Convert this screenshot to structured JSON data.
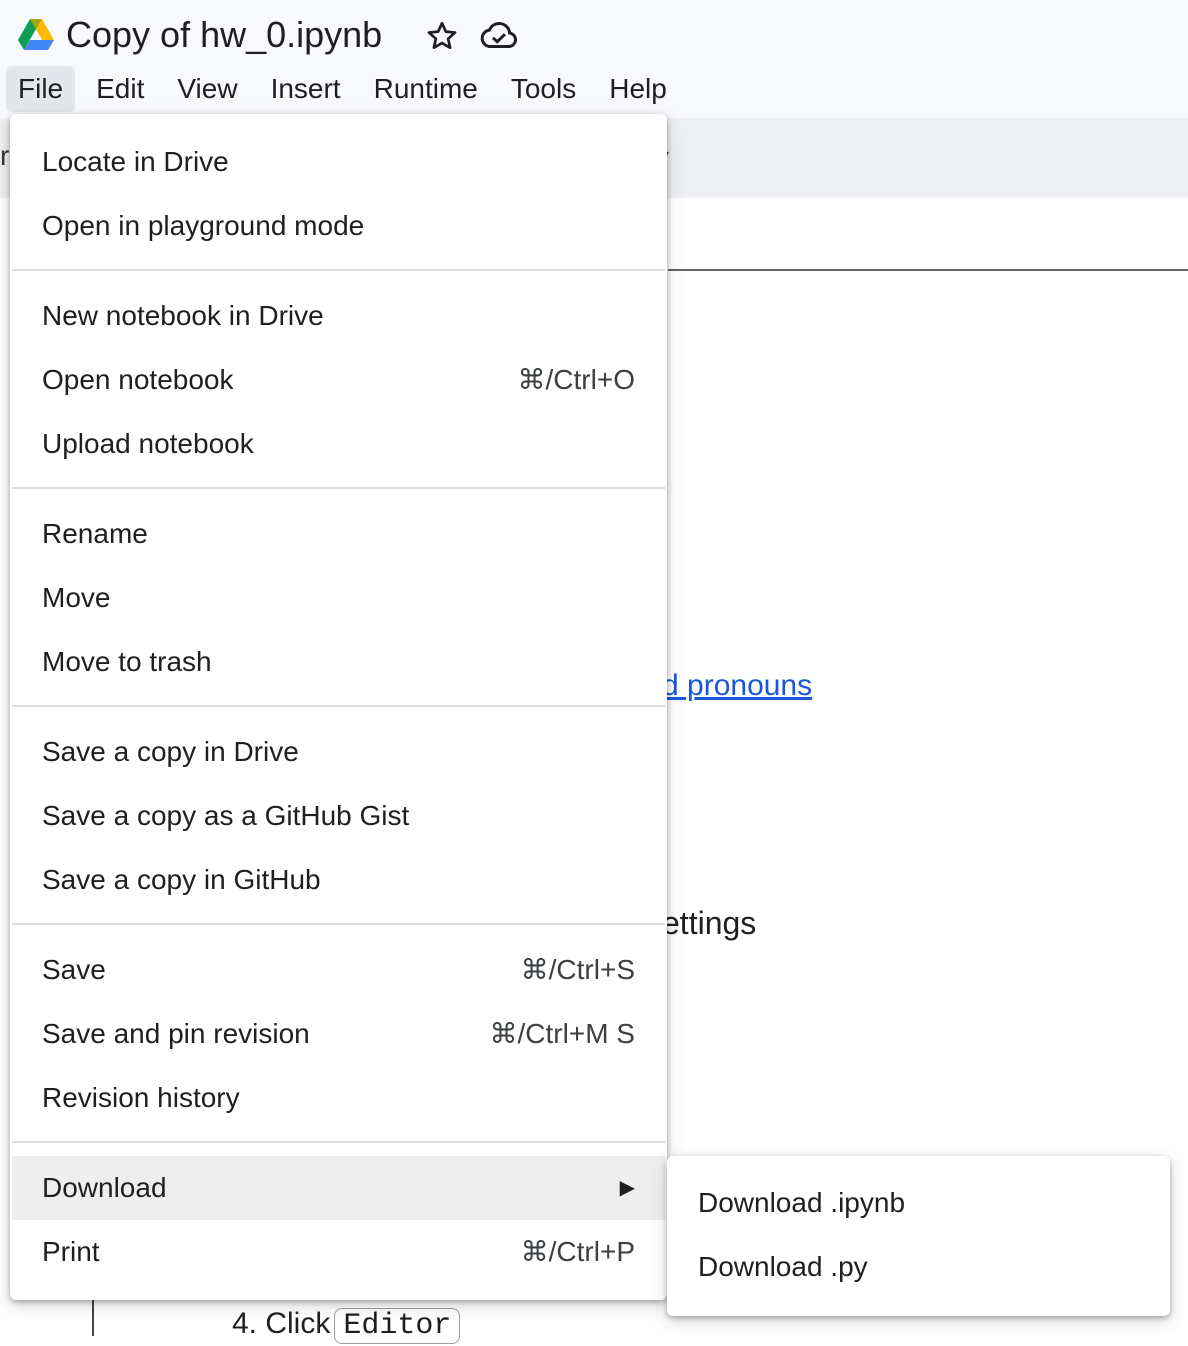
{
  "header": {
    "title": "Copy of hw_0.ipynb"
  },
  "menubar": {
    "items": [
      {
        "label": "File",
        "active": true
      },
      {
        "label": "Edit"
      },
      {
        "label": "View"
      },
      {
        "label": "Insert"
      },
      {
        "label": "Runtime"
      },
      {
        "label": "Tools"
      },
      {
        "label": "Help"
      }
    ]
  },
  "file_menu": {
    "items": [
      {
        "label": "Locate in Drive",
        "shortcut": ""
      },
      {
        "label": "Open in playground mode",
        "shortcut": ""
      },
      {
        "label": "New notebook in Drive",
        "shortcut": ""
      },
      {
        "label": "Open notebook",
        "shortcut": "⌘/Ctrl+O"
      },
      {
        "label": "Upload notebook",
        "shortcut": ""
      },
      {
        "label": "Rename",
        "shortcut": ""
      },
      {
        "label": "Move",
        "shortcut": ""
      },
      {
        "label": "Move to trash",
        "shortcut": ""
      },
      {
        "label": "Save a copy in Drive",
        "shortcut": ""
      },
      {
        "label": "Save a copy as a GitHub Gist",
        "shortcut": ""
      },
      {
        "label": "Save a copy in GitHub",
        "shortcut": ""
      },
      {
        "label": "Save",
        "shortcut": "⌘/Ctrl+S"
      },
      {
        "label": "Save and pin revision",
        "shortcut": "⌘/Ctrl+M S"
      },
      {
        "label": "Revision history",
        "shortcut": ""
      },
      {
        "label": "Download",
        "shortcut": "",
        "submenu_arrow": "▶",
        "highlighted": true
      },
      {
        "label": "Print",
        "shortcut": "⌘/Ctrl+P"
      }
    ]
  },
  "download_submenu": {
    "items": [
      {
        "label": "Download .ipynb"
      },
      {
        "label": "Download .py"
      }
    ]
  },
  "background": {
    "link_fragment": "d pronouns",
    "text_fragment": "ettings",
    "step_prefix": "4. Click",
    "step_code": "Editor",
    "left_glyph": "r",
    "toolbar_caret": "▾"
  },
  "colors": {
    "header_bg": "#f8f9fd",
    "link": "#1a56d6",
    "highlight": "#eeeeee",
    "menu_active": "#e3e6ea"
  },
  "icons": [
    "google-drive-logo",
    "star-icon",
    "cloud-saved-icon",
    "chevron-right-icon"
  ]
}
